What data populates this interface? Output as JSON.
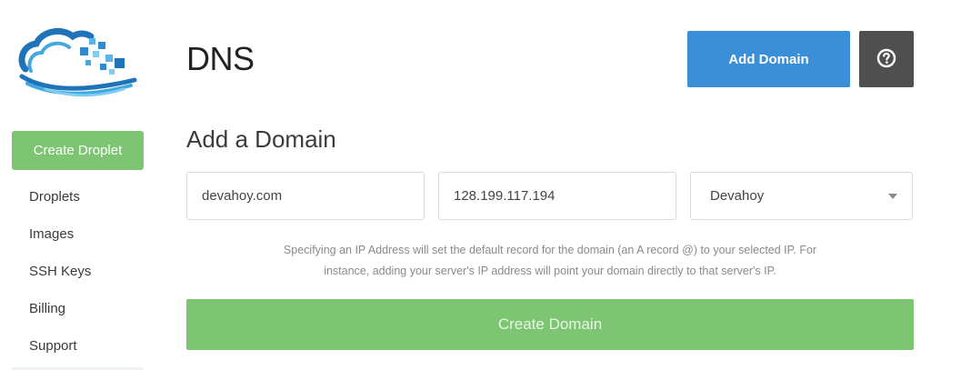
{
  "sidebar": {
    "logo_icon": "cloud-logo-icon",
    "create_button": "Create Droplet",
    "items": [
      {
        "label": "Droplets"
      },
      {
        "label": "Images"
      },
      {
        "label": "SSH Keys"
      },
      {
        "label": "Billing"
      },
      {
        "label": "Support"
      }
    ]
  },
  "header": {
    "title": "DNS",
    "add_domain": "Add Domain",
    "help_icon": "question-circle-icon"
  },
  "form": {
    "title": "Add a Domain",
    "domain_value": "devahoy.com",
    "ip_value": "128.199.117.194",
    "droplet_selected": "Devahoy",
    "hint_line1": "Specifying an IP Address will set the default record for the domain (an A record @) to your selected IP. For",
    "hint_line2": "instance, adding your server's IP address will point your domain directly to that server's IP.",
    "submit": "Create Domain"
  },
  "colors": {
    "green": "#7dc572",
    "blue": "#3a8fd6",
    "dark_gray": "#4f4f4f"
  }
}
